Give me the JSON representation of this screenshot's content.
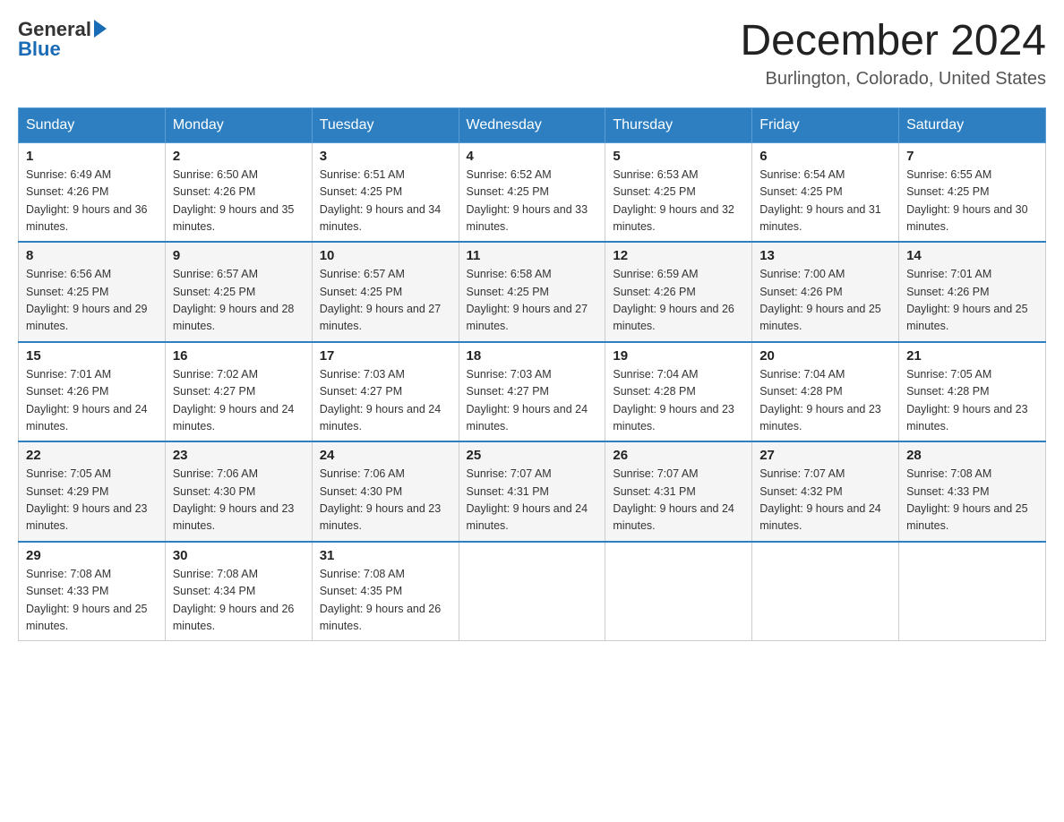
{
  "header": {
    "logo_general": "General",
    "logo_blue": "Blue",
    "month_title": "December 2024",
    "location": "Burlington, Colorado, United States"
  },
  "weekdays": [
    "Sunday",
    "Monday",
    "Tuesday",
    "Wednesday",
    "Thursday",
    "Friday",
    "Saturday"
  ],
  "weeks": [
    [
      {
        "day": "1",
        "sunrise": "6:49 AM",
        "sunset": "4:26 PM",
        "daylight": "9 hours and 36 minutes."
      },
      {
        "day": "2",
        "sunrise": "6:50 AM",
        "sunset": "4:26 PM",
        "daylight": "9 hours and 35 minutes."
      },
      {
        "day": "3",
        "sunrise": "6:51 AM",
        "sunset": "4:25 PM",
        "daylight": "9 hours and 34 minutes."
      },
      {
        "day": "4",
        "sunrise": "6:52 AM",
        "sunset": "4:25 PM",
        "daylight": "9 hours and 33 minutes."
      },
      {
        "day": "5",
        "sunrise": "6:53 AM",
        "sunset": "4:25 PM",
        "daylight": "9 hours and 32 minutes."
      },
      {
        "day": "6",
        "sunrise": "6:54 AM",
        "sunset": "4:25 PM",
        "daylight": "9 hours and 31 minutes."
      },
      {
        "day": "7",
        "sunrise": "6:55 AM",
        "sunset": "4:25 PM",
        "daylight": "9 hours and 30 minutes."
      }
    ],
    [
      {
        "day": "8",
        "sunrise": "6:56 AM",
        "sunset": "4:25 PM",
        "daylight": "9 hours and 29 minutes."
      },
      {
        "day": "9",
        "sunrise": "6:57 AM",
        "sunset": "4:25 PM",
        "daylight": "9 hours and 28 minutes."
      },
      {
        "day": "10",
        "sunrise": "6:57 AM",
        "sunset": "4:25 PM",
        "daylight": "9 hours and 27 minutes."
      },
      {
        "day": "11",
        "sunrise": "6:58 AM",
        "sunset": "4:25 PM",
        "daylight": "9 hours and 27 minutes."
      },
      {
        "day": "12",
        "sunrise": "6:59 AM",
        "sunset": "4:26 PM",
        "daylight": "9 hours and 26 minutes."
      },
      {
        "day": "13",
        "sunrise": "7:00 AM",
        "sunset": "4:26 PM",
        "daylight": "9 hours and 25 minutes."
      },
      {
        "day": "14",
        "sunrise": "7:01 AM",
        "sunset": "4:26 PM",
        "daylight": "9 hours and 25 minutes."
      }
    ],
    [
      {
        "day": "15",
        "sunrise": "7:01 AM",
        "sunset": "4:26 PM",
        "daylight": "9 hours and 24 minutes."
      },
      {
        "day": "16",
        "sunrise": "7:02 AM",
        "sunset": "4:27 PM",
        "daylight": "9 hours and 24 minutes."
      },
      {
        "day": "17",
        "sunrise": "7:03 AM",
        "sunset": "4:27 PM",
        "daylight": "9 hours and 24 minutes."
      },
      {
        "day": "18",
        "sunrise": "7:03 AM",
        "sunset": "4:27 PM",
        "daylight": "9 hours and 24 minutes."
      },
      {
        "day": "19",
        "sunrise": "7:04 AM",
        "sunset": "4:28 PM",
        "daylight": "9 hours and 23 minutes."
      },
      {
        "day": "20",
        "sunrise": "7:04 AM",
        "sunset": "4:28 PM",
        "daylight": "9 hours and 23 minutes."
      },
      {
        "day": "21",
        "sunrise": "7:05 AM",
        "sunset": "4:28 PM",
        "daylight": "9 hours and 23 minutes."
      }
    ],
    [
      {
        "day": "22",
        "sunrise": "7:05 AM",
        "sunset": "4:29 PM",
        "daylight": "9 hours and 23 minutes."
      },
      {
        "day": "23",
        "sunrise": "7:06 AM",
        "sunset": "4:30 PM",
        "daylight": "9 hours and 23 minutes."
      },
      {
        "day": "24",
        "sunrise": "7:06 AM",
        "sunset": "4:30 PM",
        "daylight": "9 hours and 23 minutes."
      },
      {
        "day": "25",
        "sunrise": "7:07 AM",
        "sunset": "4:31 PM",
        "daylight": "9 hours and 24 minutes."
      },
      {
        "day": "26",
        "sunrise": "7:07 AM",
        "sunset": "4:31 PM",
        "daylight": "9 hours and 24 minutes."
      },
      {
        "day": "27",
        "sunrise": "7:07 AM",
        "sunset": "4:32 PM",
        "daylight": "9 hours and 24 minutes."
      },
      {
        "day": "28",
        "sunrise": "7:08 AM",
        "sunset": "4:33 PM",
        "daylight": "9 hours and 25 minutes."
      }
    ],
    [
      {
        "day": "29",
        "sunrise": "7:08 AM",
        "sunset": "4:33 PM",
        "daylight": "9 hours and 25 minutes."
      },
      {
        "day": "30",
        "sunrise": "7:08 AM",
        "sunset": "4:34 PM",
        "daylight": "9 hours and 26 minutes."
      },
      {
        "day": "31",
        "sunrise": "7:08 AM",
        "sunset": "4:35 PM",
        "daylight": "9 hours and 26 minutes."
      },
      null,
      null,
      null,
      null
    ]
  ]
}
